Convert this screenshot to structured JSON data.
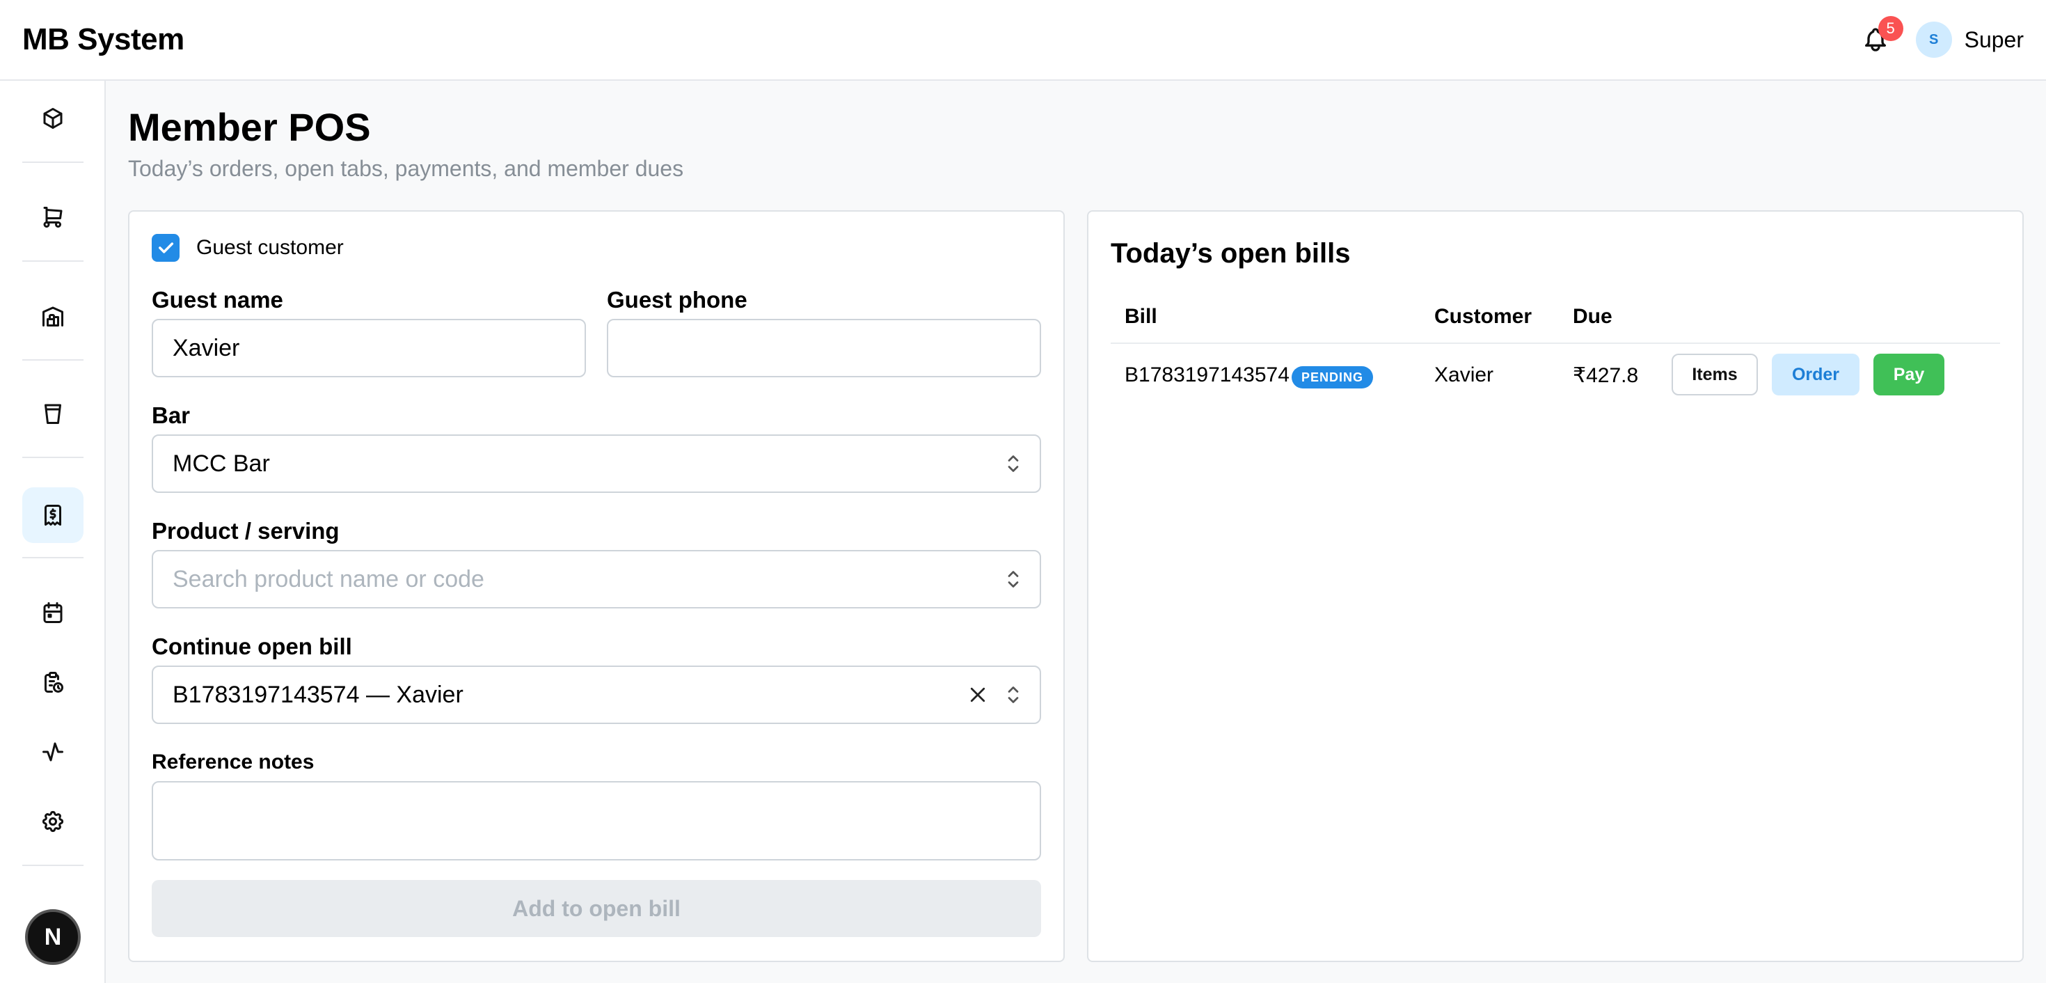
{
  "header": {
    "app_title": "MB System",
    "notification_count": "5",
    "user_initial": "S",
    "user_name": "Super"
  },
  "sidebar": {
    "items": [
      {
        "icon": "box-icon",
        "active": false
      },
      {
        "icon": "cart-icon",
        "active": false
      },
      {
        "icon": "warehouse-icon",
        "active": false
      },
      {
        "icon": "cup-icon",
        "active": false
      },
      {
        "icon": "receipt-dollar-icon",
        "active": true
      },
      {
        "icon": "calendar-icon",
        "active": false
      },
      {
        "icon": "clipboard-clock-icon",
        "active": false
      },
      {
        "icon": "activity-icon",
        "active": false
      },
      {
        "icon": "gear-icon",
        "active": false
      }
    ],
    "logo_letter": "N"
  },
  "page": {
    "title": "Member POS",
    "subtitle": "Today’s orders, open tabs, payments, and member dues"
  },
  "form": {
    "guest_checkbox_label": "Guest customer",
    "guest_checked": true,
    "guest_name_label": "Guest name",
    "guest_name_value": "Xavier",
    "guest_phone_label": "Guest phone",
    "guest_phone_value": "",
    "bar_label": "Bar",
    "bar_value": "MCC Bar",
    "product_label": "Product / serving",
    "product_placeholder": "Search product name or code",
    "open_bill_label": "Continue open bill",
    "open_bill_value": "B1783197143574 — Xavier",
    "notes_label": "Reference notes",
    "notes_value": "",
    "add_button_label": "Add to open bill"
  },
  "bills": {
    "title": "Today’s open bills",
    "columns": [
      "Bill",
      "Customer",
      "Due"
    ],
    "rows": [
      {
        "bill": "B1783197143574",
        "status": "PENDING",
        "customer": "Xavier",
        "due": "₹427.8",
        "actions": [
          "Items",
          "Order",
          "Pay"
        ]
      }
    ]
  },
  "colors": {
    "accent": "#228be6",
    "pay": "#40c057",
    "order_bg": "#d0ebff",
    "badge": "#fa5252"
  }
}
